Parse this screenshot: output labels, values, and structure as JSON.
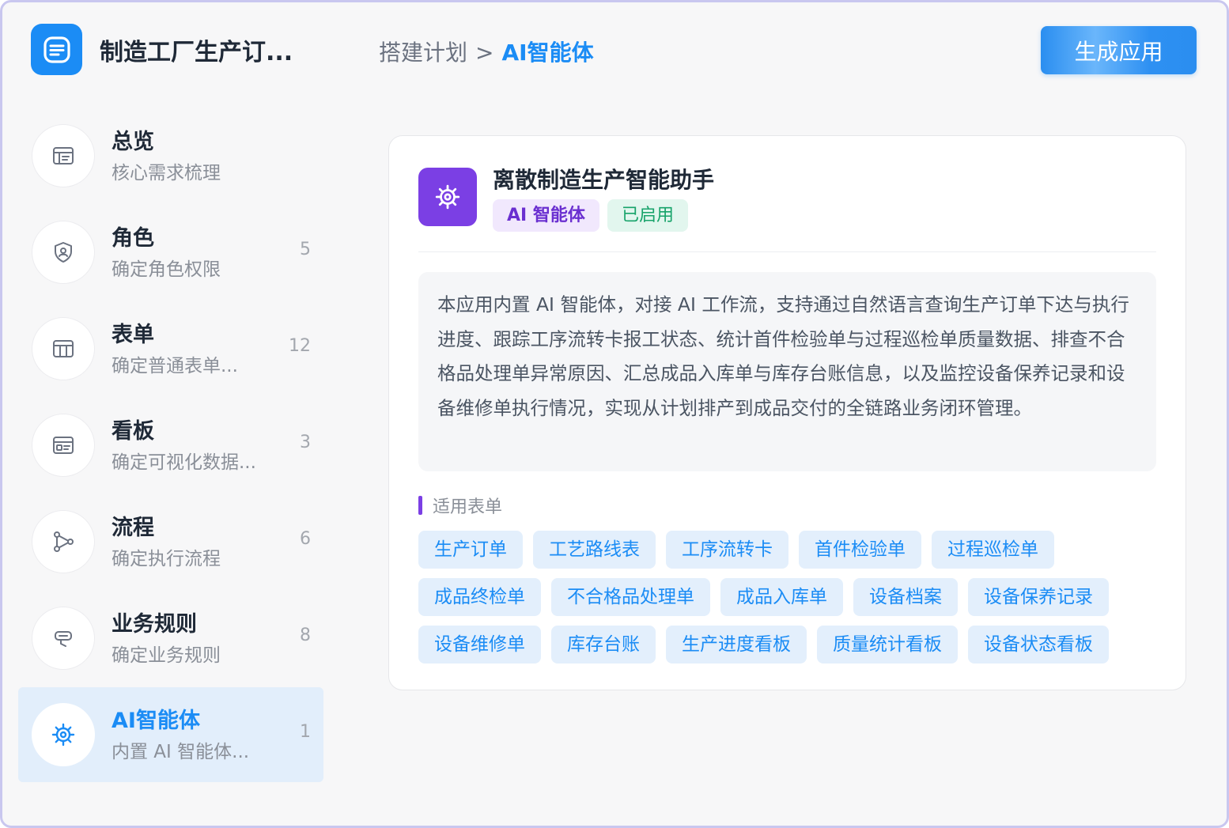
{
  "app": {
    "title": "制造工厂生产订...",
    "logo_icon": "document-list-icon",
    "accent": "#1b8cf5"
  },
  "breadcrumb": {
    "parent": "搭建计划",
    "separator": ">",
    "current": "AI智能体"
  },
  "header": {
    "generate_label": "生成应用"
  },
  "sidebar": {
    "items": [
      {
        "title": "总览",
        "subtitle": "核心需求梳理",
        "count": "",
        "icon": "overview-icon"
      },
      {
        "title": "角色",
        "subtitle": "确定角色权限",
        "count": "5",
        "icon": "shield-user-icon"
      },
      {
        "title": "表单",
        "subtitle": "确定普通表单...",
        "count": "12",
        "icon": "table-icon"
      },
      {
        "title": "看板",
        "subtitle": "确定可视化数据...",
        "count": "3",
        "icon": "dashboard-icon"
      },
      {
        "title": "流程",
        "subtitle": "确定执行流程",
        "count": "6",
        "icon": "flow-icon"
      },
      {
        "title": "业务规则",
        "subtitle": "确定业务规则",
        "count": "8",
        "icon": "rule-icon"
      },
      {
        "title": "AI智能体",
        "subtitle": "内置 AI 智能体...",
        "count": "1",
        "icon": "agent-gear-icon",
        "active": true
      }
    ]
  },
  "agent": {
    "name": "离散制造生产智能助手",
    "icon": "agent-gear-icon",
    "tags": {
      "type": "AI 智能体",
      "status": "已启用"
    },
    "description": "本应用内置 AI 智能体，对接 AI 工作流，支持通过自然语言查询生产订单下达与执行进度、跟踪工序流转卡报工状态、统计首件检验单与过程巡检单质量数据、排查不合格品处理单异常原因、汇总成品入库单与库存台账信息，以及监控设备保养记录和设备维修单执行情况，实现从计划排产到成品交付的全链路业务闭环管理。",
    "section_title": "适用表单",
    "forms": [
      "生产订单",
      "工艺路线表",
      "工序流转卡",
      "首件检验单",
      "过程巡检单",
      "成品终检单",
      "不合格品处理单",
      "成品入库单",
      "设备档案",
      "设备保养记录",
      "设备维修单",
      "库存台账",
      "生产进度看板",
      "质量统计看板",
      "设备状态看板"
    ]
  }
}
